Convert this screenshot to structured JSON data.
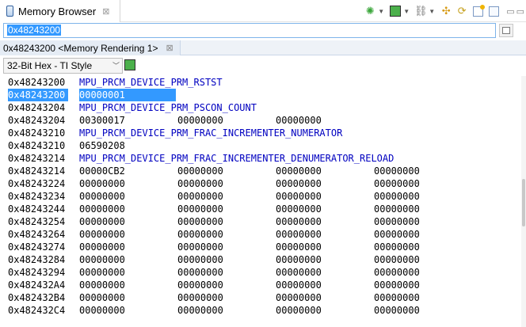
{
  "view": {
    "title": "Memory Browser",
    "close_glyph": "⊠"
  },
  "toolbar": {
    "icons": [
      "gear-icon",
      "chip-icon",
      "chain-icon",
      "tool-a-icon",
      "tool-b-icon",
      "new-rendering-icon",
      "export-icon"
    ]
  },
  "address_bar": {
    "value": "0x48243200"
  },
  "rendering_tab": {
    "label": "0x48243200 <Memory Rendering 1>",
    "close_glyph": "⊠"
  },
  "format": {
    "selected": "32-Bit Hex - TI Style"
  },
  "memory": {
    "rows": [
      {
        "addr": "0x48243200",
        "reg": "MPU_PRCM_DEVICE_PRM_RSTST"
      },
      {
        "addr": "0x48243200",
        "values": [
          "00000001"
        ],
        "selected": true
      },
      {
        "addr": "0x48243204",
        "reg": "MPU_PRCM_DEVICE_PRM_PSCON_COUNT"
      },
      {
        "addr": "0x48243204",
        "values": [
          "00300017",
          "00000000",
          "00000000"
        ]
      },
      {
        "addr": "0x48243210",
        "reg": "MPU_PRCM_DEVICE_PRM_FRAC_INCREMENTER_NUMERATOR"
      },
      {
        "addr": "0x48243210",
        "values": [
          "06590208"
        ]
      },
      {
        "addr": "0x48243214",
        "reg": "MPU_PRCM_DEVICE_PRM_FRAC_INCREMENTER_DENUMERATOR_RELOAD"
      },
      {
        "addr": "0x48243214",
        "values": [
          "00000CB2",
          "00000000",
          "00000000",
          "00000000"
        ]
      },
      {
        "addr": "0x48243224",
        "values": [
          "00000000",
          "00000000",
          "00000000",
          "00000000"
        ]
      },
      {
        "addr": "0x48243234",
        "values": [
          "00000000",
          "00000000",
          "00000000",
          "00000000"
        ]
      },
      {
        "addr": "0x48243244",
        "values": [
          "00000000",
          "00000000",
          "00000000",
          "00000000"
        ]
      },
      {
        "addr": "0x48243254",
        "values": [
          "00000000",
          "00000000",
          "00000000",
          "00000000"
        ]
      },
      {
        "addr": "0x48243264",
        "values": [
          "00000000",
          "00000000",
          "00000000",
          "00000000"
        ]
      },
      {
        "addr": "0x48243274",
        "values": [
          "00000000",
          "00000000",
          "00000000",
          "00000000"
        ]
      },
      {
        "addr": "0x48243284",
        "values": [
          "00000000",
          "00000000",
          "00000000",
          "00000000"
        ]
      },
      {
        "addr": "0x48243294",
        "values": [
          "00000000",
          "00000000",
          "00000000",
          "00000000"
        ]
      },
      {
        "addr": "0x482432A4",
        "values": [
          "00000000",
          "00000000",
          "00000000",
          "00000000"
        ]
      },
      {
        "addr": "0x482432B4",
        "values": [
          "00000000",
          "00000000",
          "00000000",
          "00000000"
        ]
      },
      {
        "addr": "0x482432C4",
        "values": [
          "00000000",
          "00000000",
          "00000000",
          "00000000"
        ]
      }
    ]
  },
  "colors": {
    "register_name": "#0000c0",
    "selection": "#3399ff"
  }
}
